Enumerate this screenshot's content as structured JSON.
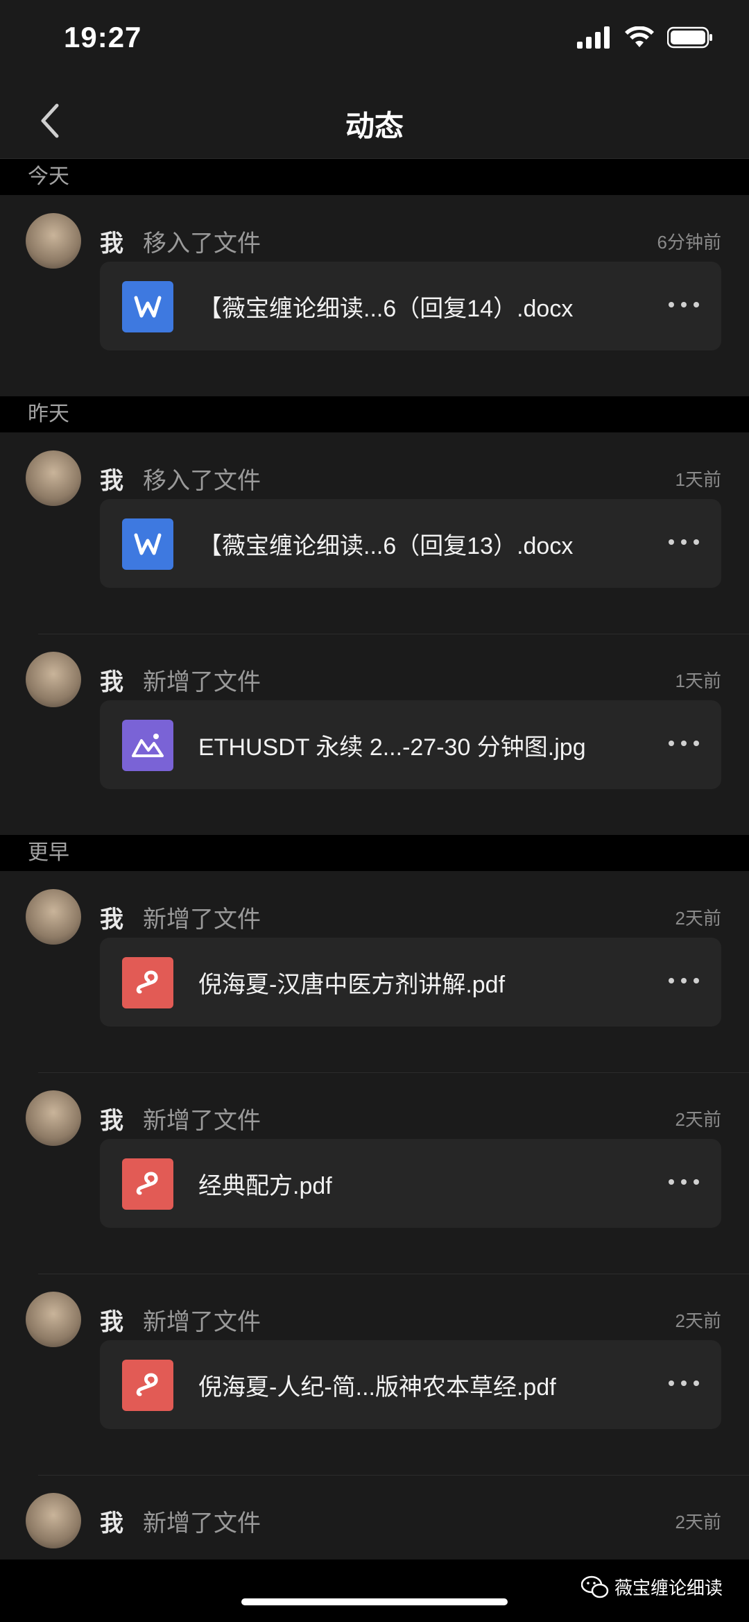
{
  "status": {
    "time": "19:27"
  },
  "nav": {
    "title": "动态"
  },
  "sections": [
    {
      "header": "今天",
      "items": [
        {
          "user": "我",
          "action": "移入了文件",
          "time": "6分钟前",
          "file": {
            "name": "【薇宝缠论细读...6（回复14）.docx",
            "type": "word"
          }
        }
      ]
    },
    {
      "header": "昨天",
      "items": [
        {
          "user": "我",
          "action": "移入了文件",
          "time": "1天前",
          "file": {
            "name": "【薇宝缠论细读...6（回复13）.docx",
            "type": "word"
          }
        },
        {
          "user": "我",
          "action": "新增了文件",
          "time": "1天前",
          "file": {
            "name": "ETHUSDT 永续 2...-27-30 分钟图.jpg",
            "type": "image"
          }
        }
      ]
    },
    {
      "header": "更早",
      "items": [
        {
          "user": "我",
          "action": "新增了文件",
          "time": "2天前",
          "file": {
            "name": "倪海夏-汉唐中医方剂讲解.pdf",
            "type": "pdf"
          }
        },
        {
          "user": "我",
          "action": "新增了文件",
          "time": "2天前",
          "file": {
            "name": "经典配方.pdf",
            "type": "pdf"
          }
        },
        {
          "user": "我",
          "action": "新增了文件",
          "time": "2天前",
          "file": {
            "name": "倪海夏-人纪-简...版神农本草经.pdf",
            "type": "pdf"
          }
        },
        {
          "user": "我",
          "action": "新增了文件",
          "time": "2天前",
          "file": null
        }
      ]
    }
  ],
  "watermark": "薇宝缠论细读",
  "colors": {
    "word": "#3e79e0",
    "image": "#7a63d6",
    "pdf": "#e25b55"
  }
}
